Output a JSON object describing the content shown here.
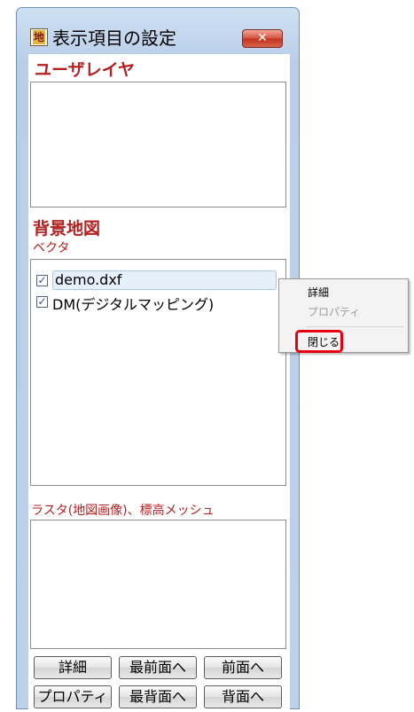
{
  "window": {
    "title": "表示項目の設定",
    "icon_name": "map-app-icon",
    "icon_glyph": "地",
    "close_glyph": "✕"
  },
  "user_layer": {
    "heading": "ユーザレイヤ",
    "items": []
  },
  "background_map": {
    "heading": "背景地図",
    "vector": {
      "label": "ベクタ",
      "items": [
        {
          "label": "demo.dxf",
          "checked": true,
          "selected": true
        },
        {
          "label": "DM(デジタルマッピング)",
          "checked": true,
          "selected": false
        }
      ]
    },
    "raster": {
      "label": "ラスタ(地図画像)、標高メッシュ",
      "items": []
    }
  },
  "buttons": {
    "detail": "詳細",
    "front_most": "最前面へ",
    "forward": "前面へ",
    "properties": "プロパティ",
    "back_most": "最背面へ",
    "backward": "背面へ"
  },
  "context_menu": {
    "items": [
      {
        "label": "詳細",
        "enabled": true
      },
      {
        "label": "プロパティ",
        "enabled": false
      },
      {
        "label": "閉じる",
        "enabled": true,
        "highlighted": true
      }
    ]
  },
  "colors": {
    "heading": "#b32121",
    "highlight_box": "#e60012",
    "close_button": "#c2321c"
  }
}
